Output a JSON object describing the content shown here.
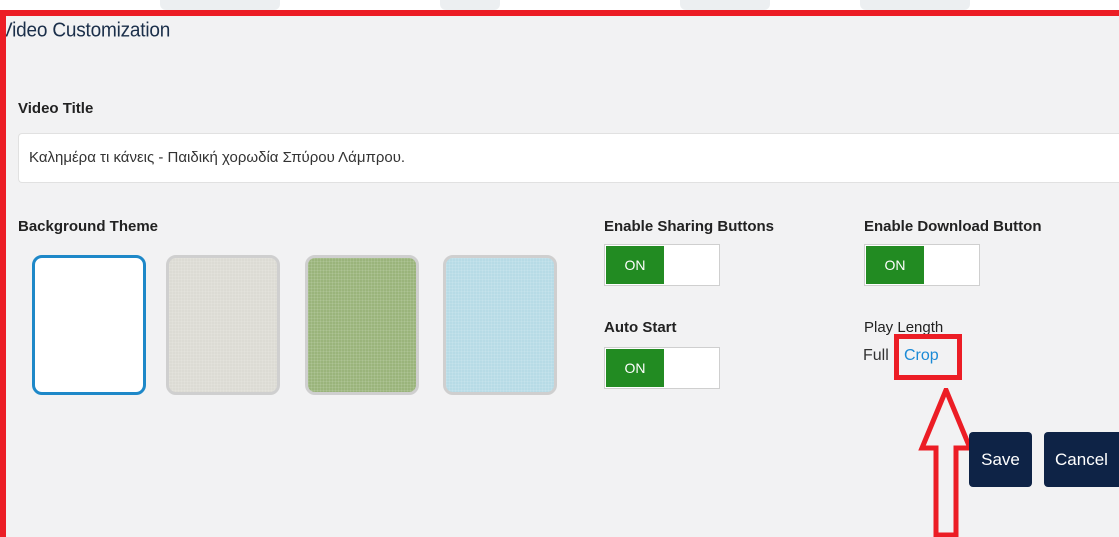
{
  "header": {
    "title": "Video Customization"
  },
  "video_title": {
    "label": "Video Title",
    "value": "Καλημέρα τι κάνεις - Παιδική χορωδία Σπύρου Λάμπρου."
  },
  "background_theme": {
    "label": "Background Theme",
    "swatches": [
      {
        "color": "#ffffff",
        "selected": true
      },
      {
        "color": "#dcdbd4",
        "selected": false
      },
      {
        "color": "#9ab47b",
        "selected": false
      },
      {
        "color": "#b7dbe6",
        "selected": false
      }
    ]
  },
  "sharing": {
    "label": "Enable Sharing Buttons",
    "state": "ON"
  },
  "download": {
    "label": "Enable Download Button",
    "state": "ON"
  },
  "auto_start": {
    "label": "Auto Start",
    "state": "ON"
  },
  "play_length": {
    "label": "Play Length",
    "full": "Full",
    "crop": "Crop"
  },
  "actions": {
    "save": "Save",
    "cancel": "Cancel"
  },
  "colors": {
    "highlight": "#ec1d25",
    "toggle_on": "#228b22",
    "button": "#0e2346",
    "link": "#1a8ad6",
    "selected_border": "#1e88c8"
  }
}
